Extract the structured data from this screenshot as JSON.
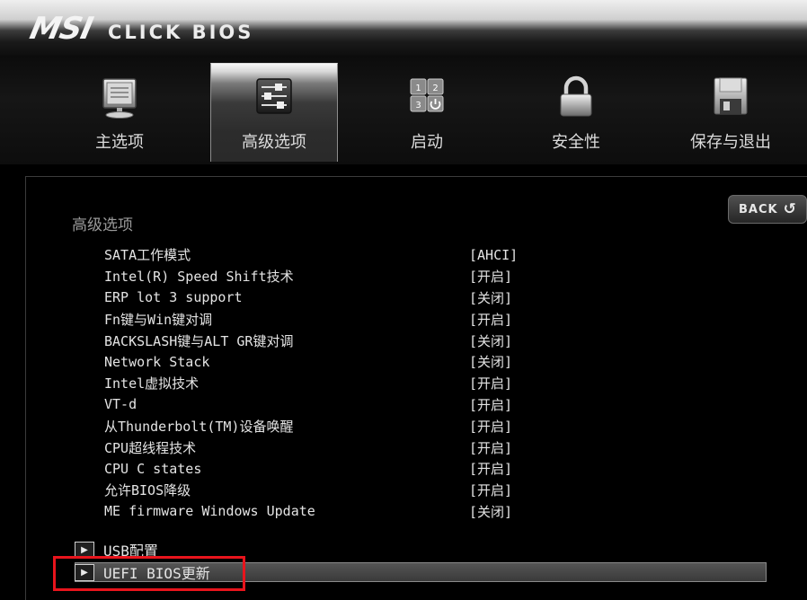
{
  "header": {
    "brand": "MSI",
    "product": "CLICK BIOS"
  },
  "tabs": [
    {
      "label": "主选项",
      "icon": "monitor-icon",
      "active": false
    },
    {
      "label": "高级选项",
      "icon": "settings-sliders-icon",
      "active": true
    },
    {
      "label": "启动",
      "icon": "boot-keys-icon",
      "active": false
    },
    {
      "label": "安全性",
      "icon": "padlock-icon",
      "active": false
    },
    {
      "label": "保存与退出",
      "icon": "floppy-disk-icon",
      "active": false
    }
  ],
  "back_label": "BACK",
  "section_title": "高级选项",
  "settings": [
    {
      "name": "SATA工作模式",
      "value": "[AHCI]"
    },
    {
      "name": "Intel(R) Speed Shift技术",
      "value": "[开启]"
    },
    {
      "name": "ERP lot 3 support",
      "value": "[关闭]"
    },
    {
      "name": "Fn键与Win键对调",
      "value": "[开启]"
    },
    {
      "name": "BACKSLASH键与ALT GR键对调",
      "value": "[关闭]"
    },
    {
      "name": "Network Stack",
      "value": "[关闭]"
    },
    {
      "name": "Intel虚拟技术",
      "value": "[开启]"
    },
    {
      "name": "VT-d",
      "value": "[开启]"
    },
    {
      "name": "从Thunderbolt(TM)设备唤醒",
      "value": "[开启]"
    },
    {
      "name": "CPU超线程技术",
      "value": "[开启]"
    },
    {
      "name": "CPU C states",
      "value": "[开启]"
    },
    {
      "name": "允许BIOS降级",
      "value": "[开启]"
    },
    {
      "name": "ME firmware Windows Update",
      "value": "[关闭]"
    }
  ],
  "submenus": [
    {
      "label": "USB配置",
      "selected": false
    },
    {
      "label": "UEFI BIOS更新",
      "selected": true
    }
  ],
  "colors": {
    "highlight": "#e8141c",
    "text": "#e4e4e4",
    "section_title": "#9a9a9a"
  }
}
